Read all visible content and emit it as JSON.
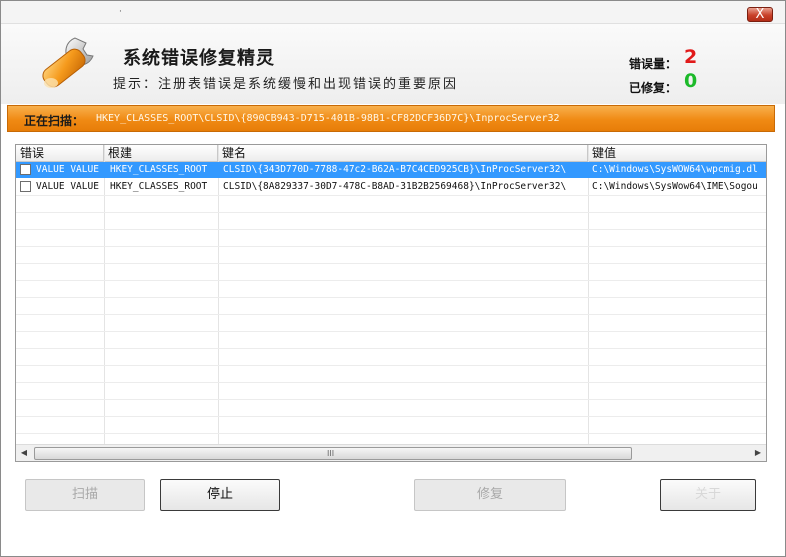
{
  "window": {
    "title_small": "·",
    "close_label": "X"
  },
  "header": {
    "title": "系统错误修复精灵",
    "hint": "提示：注册表错误是系统缓慢和出现错误的重要原因",
    "error_label": "错误量：",
    "error_count": "2",
    "fixed_label": "已修复：",
    "fixed_count": "0"
  },
  "scan": {
    "label": "正在扫描：",
    "path": "HKEY_CLASSES_ROOT\\CLSID\\{890CB943-D715-401B-98B1-CF82DCF36D7C}\\InprocServer32"
  },
  "table": {
    "columns": [
      "错误",
      "根建",
      "键名",
      "键值"
    ],
    "rows": [
      {
        "error": "VALUE VALUE",
        "root": "HKEY_CLASSES_ROOT",
        "key": "CLSID\\{343D770D-7788-47c2-B62A-B7C4CED925CB}\\InProcServer32\\",
        "value": "C:\\Windows\\SysWOW64\\wpcmig.dl",
        "selected": true
      },
      {
        "error": "VALUE VALUE",
        "root": "HKEY_CLASSES_ROOT",
        "key": "CLSID\\{8A829337-30D7-478C-B8AD-31B2B2569468}\\InProcServer32\\",
        "value": "C:\\Windows\\SysWow64\\IME\\Sogou",
        "selected": false
      }
    ],
    "scroll_grip": "III"
  },
  "buttons": {
    "scan": "扫描",
    "stop": "停止",
    "repair": "修复",
    "about": "关于"
  },
  "colors": {
    "accent": "#f08a14",
    "error": "#e11a1a",
    "fixed": "#1cba2a",
    "selection": "#3399ff"
  }
}
